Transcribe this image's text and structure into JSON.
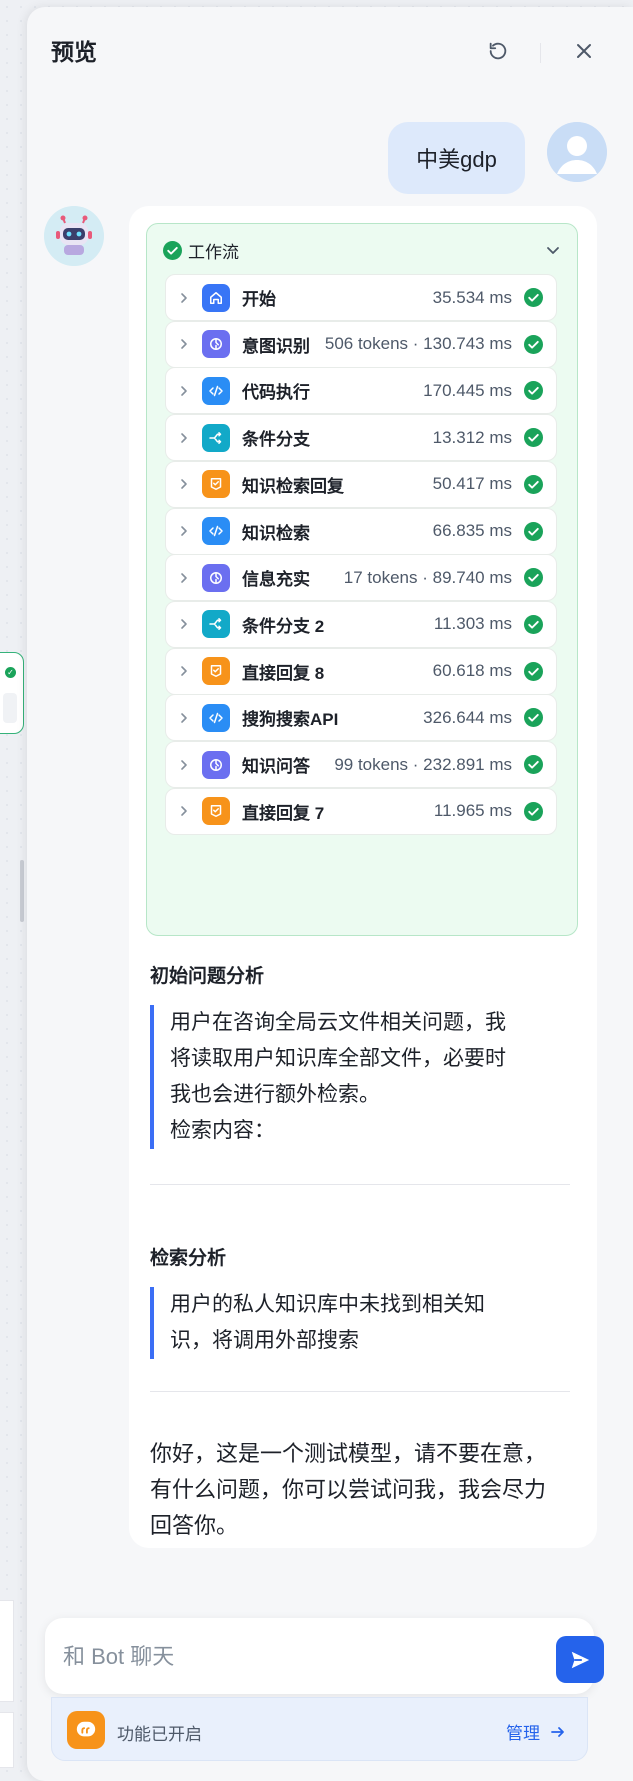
{
  "header": {
    "title": "预览",
    "refresh_icon": "refresh-icon",
    "close_icon": "close-icon"
  },
  "user_message": {
    "text": "中美gdp",
    "avatar_icon": "user-avatar-icon"
  },
  "bot": {
    "avatar_icon": "robot-avatar-icon",
    "workflow": {
      "title": "工作流",
      "status_color": "#1aa35a",
      "steps": [
        {
          "name": "开始",
          "meta": "35.534 ms",
          "icon": "home-icon",
          "color": "#3875f6"
        },
        {
          "name": "意图识别",
          "meta": "506 tokens · 130.743 ms",
          "icon": "intent-icon",
          "color": "#6b6ff0"
        },
        {
          "name": "代码执行",
          "meta": "170.445 ms",
          "icon": "code-icon",
          "color": "#2a8df5"
        },
        {
          "name": "条件分支",
          "meta": "13.312 ms",
          "icon": "branch-icon",
          "color": "#12a9c8"
        },
        {
          "name": "知识检索回复",
          "meta": "50.417 ms",
          "icon": "reply-icon",
          "color": "#f7931a"
        },
        {
          "name": "知识检索",
          "meta": "66.835 ms",
          "icon": "code-icon",
          "color": "#2a8df5"
        },
        {
          "name": "信息充实",
          "meta": "17 tokens · 89.740 ms",
          "icon": "intent-icon",
          "color": "#6b6ff0"
        },
        {
          "name": "条件分支 2",
          "meta": "11.303 ms",
          "icon": "branch-icon",
          "color": "#12a9c8"
        },
        {
          "name": "直接回复 8",
          "meta": "60.618 ms",
          "icon": "reply-icon",
          "color": "#f7931a"
        },
        {
          "name": "搜狗搜索API",
          "meta": "326.644 ms",
          "icon": "code-icon",
          "color": "#2a8df5"
        },
        {
          "name": "知识问答",
          "meta": "99 tokens · 232.891 ms",
          "icon": "intent-icon",
          "color": "#6b6ff0"
        },
        {
          "name": "直接回复 7",
          "meta": "11.965 ms",
          "icon": "reply-icon",
          "color": "#f7931a"
        }
      ]
    },
    "section1": {
      "title": "初始问题分析",
      "lines": [
        "用户在咨询全局云文件相关问题，我",
        "将读取用户知识库全部文件，必要时",
        "我也会进行额外检索。",
        "检索内容："
      ]
    },
    "section2": {
      "title": "检索分析",
      "lines": [
        "用户的私人知识库中未找到相关知",
        "识，将调用外部搜索"
      ]
    },
    "answer_lines": [
      "你好，这是一个测试模型，请不要在意，",
      "有什么问题，你可以尝试问我，我会尽力",
      "回答你。"
    ]
  },
  "input": {
    "placeholder": "和 Bot 聊天",
    "value": "",
    "send_icon": "send-icon"
  },
  "feature_bar": {
    "icon": "quote-icon",
    "label": "功能已开启",
    "manage_label": "管理",
    "accent": "#2563eb"
  }
}
